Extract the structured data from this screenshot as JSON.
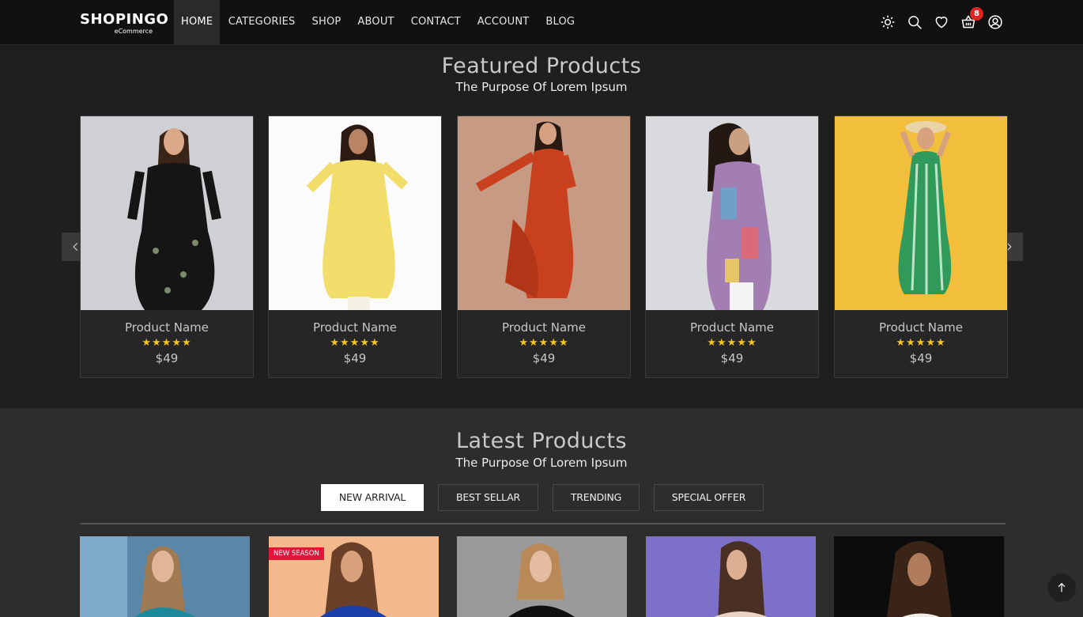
{
  "brand": {
    "name": "SHOPINGO",
    "tagline": "eCommerce"
  },
  "nav": {
    "items": [
      {
        "label": "HOME",
        "active": true
      },
      {
        "label": "CATEGORIES"
      },
      {
        "label": "SHOP"
      },
      {
        "label": "ABOUT"
      },
      {
        "label": "CONTACT"
      },
      {
        "label": "ACCOUNT"
      },
      {
        "label": "BLOG"
      }
    ],
    "icons": [
      "sun-icon",
      "search-icon",
      "heart-icon",
      "cart-icon",
      "user-icon"
    ],
    "cart_count": "8"
  },
  "featured": {
    "title": "Featured Products",
    "subtitle": "The Purpose Of Lorem Ipsum",
    "products": [
      {
        "name": "Product Name",
        "stars": "★★★★★",
        "price": "$49"
      },
      {
        "name": "Product Name",
        "stars": "★★★★★",
        "price": "$49"
      },
      {
        "name": "Product Name",
        "stars": "★★★★★",
        "price": "$49"
      },
      {
        "name": "Product Name",
        "stars": "★★★★★",
        "price": "$49"
      },
      {
        "name": "Product Name",
        "stars": "★★★★★",
        "price": "$49"
      }
    ],
    "rating": 5
  },
  "latest": {
    "title": "Latest Products",
    "subtitle": "The Purpose Of Lorem Ipsum",
    "tabs": [
      {
        "label": "NEW ARRIVAL",
        "active": true
      },
      {
        "label": "BEST SELLAR"
      },
      {
        "label": "TRENDING"
      },
      {
        "label": "SPECIAL OFFER"
      }
    ],
    "tag": "NEW SEASON"
  },
  "colors": {
    "accent": "#f5c518",
    "badge": "#e02424",
    "tag": "#e0163a",
    "header_bg": "#111111",
    "page_bg": "#1f1f1f"
  }
}
